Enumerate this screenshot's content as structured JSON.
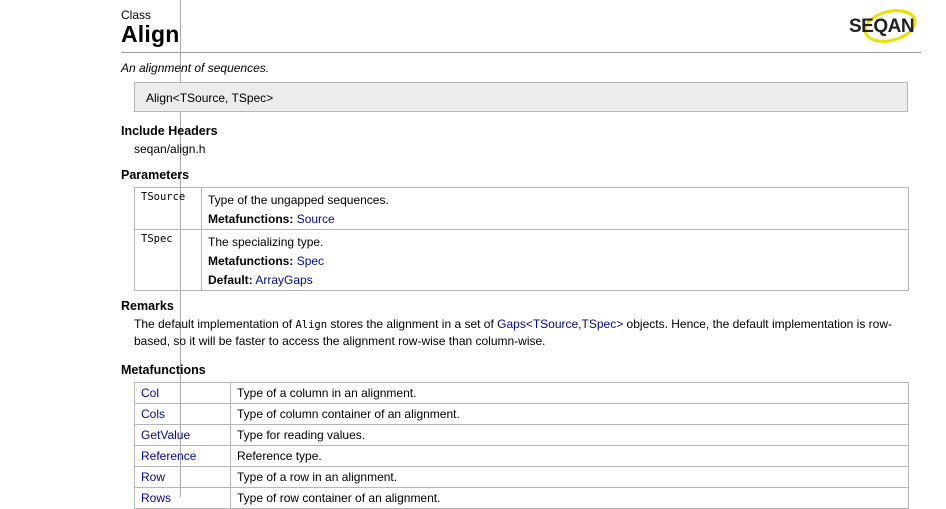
{
  "header": {
    "kind": "Class",
    "title": "Align",
    "brief": "An alignment of sequences.",
    "logo_text": "SEQAN"
  },
  "signature": "Align<TSource, TSpec>",
  "include": {
    "heading": "Include Headers",
    "path": "seqan/align.h"
  },
  "parameters": {
    "heading": "Parameters",
    "rows": [
      {
        "name": "TSource",
        "desc": "Type of the ungapped sequences.",
        "meta_label": "Metafunctions:",
        "meta_link": "Source"
      },
      {
        "name": "TSpec",
        "desc": "The specializing type.",
        "meta_label": "Metafunctions:",
        "meta_link": "Spec",
        "default_label": "Default:",
        "default_link": "ArrayGaps"
      }
    ]
  },
  "remarks": {
    "heading": "Remarks",
    "part1": "The default implementation of ",
    "code": "Align",
    "part2": " stores the alignment in a set of ",
    "link": "Gaps<TSource,TSpec>",
    "part3": " objects. Hence, the default implementation is row-based, so it will be faster to access the alignment row-wise than column-wise."
  },
  "metafunctions": {
    "heading": "Metafunctions",
    "rows": [
      {
        "name": "Col",
        "desc": "Type of a column in an alignment."
      },
      {
        "name": "Cols",
        "desc": "Type of column container of an alignment."
      },
      {
        "name": "GetValue",
        "desc": "Type for reading values."
      },
      {
        "name": "Reference",
        "desc": "Reference type."
      },
      {
        "name": "Row",
        "desc": "Type of a row in an alignment."
      },
      {
        "name": "Rows",
        "desc": "Type of row container of an alignment."
      }
    ]
  },
  "colors": {
    "link": "#000a8c",
    "box_bg": "#ececec",
    "border": "#b5b5b5",
    "logo_ring": "#e8e000"
  }
}
